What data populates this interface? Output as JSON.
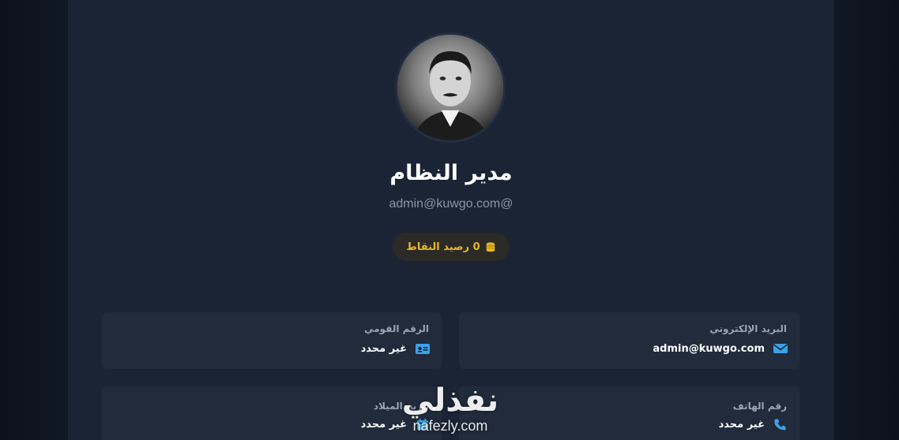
{
  "profile": {
    "name": "مدير النظام",
    "email": "admin@kuwgo.com@",
    "points_label": "0 رصيد النقاط",
    "avatar_icon": "user-avatar"
  },
  "info": {
    "email_label": "البريد الإلكتروني",
    "email_value": "admin@kuwgo.com",
    "national_id_label": "الرقم القومي",
    "national_id_value": "غير محدد",
    "phone_label": "رقم الهاتف",
    "phone_value": "غير محدد",
    "birthdate_label": "تاريخ الميلاد",
    "birthdate_value": "غير محدد"
  },
  "watermark": {
    "arabic": "نفذلي",
    "latin": "nafezly.com"
  },
  "colors": {
    "accent": "#3aa3e8",
    "points": "#e8b725",
    "card": "#1a2434",
    "box": "#212b3b"
  }
}
